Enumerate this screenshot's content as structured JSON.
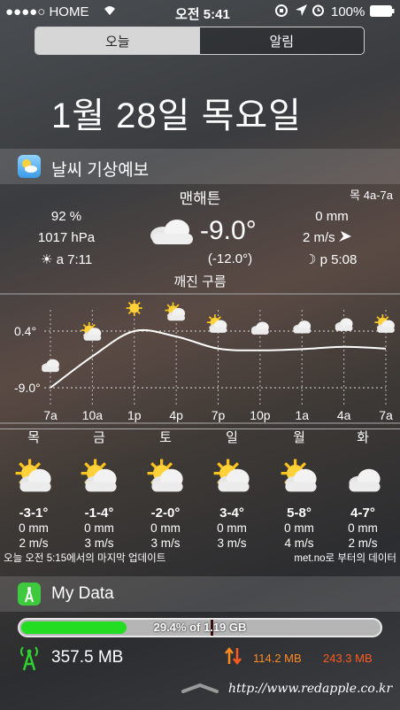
{
  "status": {
    "carrier": "●●●●○ HOME",
    "time": "오전 5:41",
    "battery": "100%"
  },
  "tabs": [
    {
      "label": "오늘",
      "active": true
    },
    {
      "label": "알림",
      "active": false
    }
  ],
  "date": "1월 28일 목요일",
  "weather": {
    "section_title": "날씨 기상예보",
    "city": "맨해튼",
    "period": "목 4a-7a",
    "humidity": "92 %",
    "pressure": "1017 hPa",
    "sunrise": "a 7:11",
    "temperature": "-9.0°",
    "feels_like": "(-12.0°)",
    "precipitation": "0 mm",
    "wind": "2 m/s",
    "moonset": "p 5:08",
    "condition": "깨진 구름",
    "footer_left": "오늘 오전 5:15에서의 마지막 업데이트",
    "footer_right": "met.no로 부터의 데이터"
  },
  "chart_data": {
    "type": "line",
    "x": [
      "7a",
      "10a",
      "1p",
      "4p",
      "7p",
      "10p",
      "1a",
      "4a",
      "7a"
    ],
    "y_labels": [
      "0.4°",
      "-9.0°"
    ],
    "y": [
      -9.0,
      -3.8,
      0.4,
      -0.5,
      -2.5,
      -2.8,
      -2.6,
      -2.2,
      -2.5
    ],
    "ylim": [
      -9.0,
      0.4
    ],
    "icons": [
      "cloudy",
      "sun-cloud",
      "sun",
      "sun-cloud",
      "sun-cloud",
      "cloudy",
      "cloudy",
      "cloudy",
      "sun-cloud"
    ]
  },
  "daily": [
    {
      "day": "목",
      "temp": "-3-1°",
      "precip": "0 mm",
      "wind": "2 m/s",
      "icon": "sun-cloud"
    },
    {
      "day": "금",
      "temp": "-1-4°",
      "precip": "0 mm",
      "wind": "3 m/s",
      "icon": "sun-cloud"
    },
    {
      "day": "토",
      "temp": "-2-0°",
      "precip": "0 mm",
      "wind": "3 m/s",
      "icon": "sun-cloud"
    },
    {
      "day": "일",
      "temp": "3-4°",
      "precip": "0 mm",
      "wind": "3 m/s",
      "icon": "sun-cloud"
    },
    {
      "day": "월",
      "temp": "5-8°",
      "precip": "0 mm",
      "wind": "4 m/s",
      "icon": "sun-cloud"
    },
    {
      "day": "화",
      "temp": "4-7°",
      "precip": "0 mm",
      "wind": "2 m/s",
      "icon": "cloudy"
    }
  ],
  "mydata": {
    "section_title": "My Data",
    "usage_label": "29.4% of 1.19 GB",
    "usage_fraction": 0.294,
    "cellular": "357.5 MB",
    "upload": "114.2 MB",
    "download": "243.3 MB",
    "accent_green": "#22dd22",
    "accent_orange": "#ff5a1f"
  },
  "watermark": "http://www.redapple.co.kr"
}
